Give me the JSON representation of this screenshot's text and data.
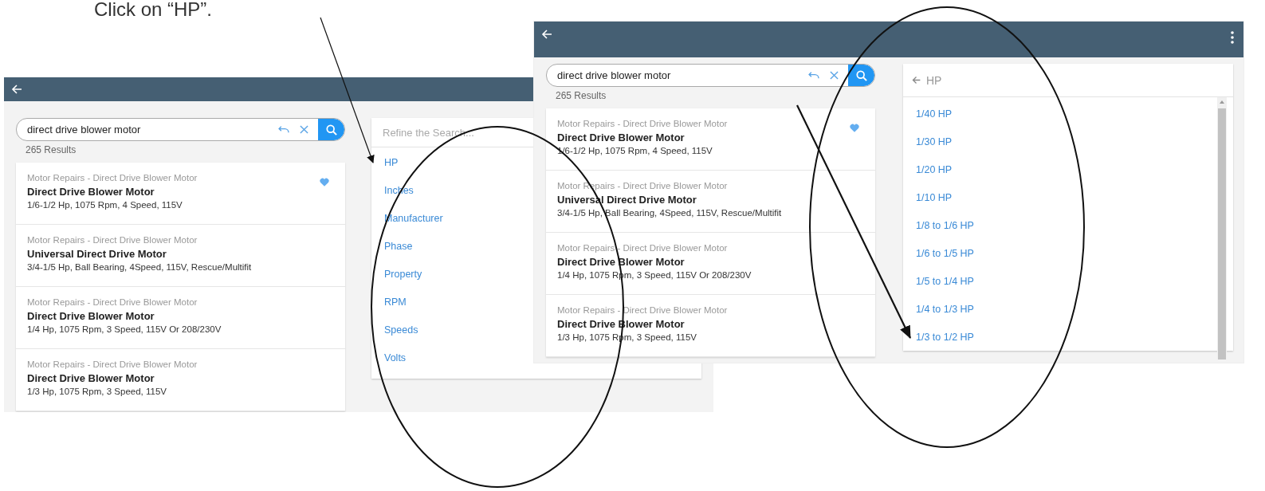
{
  "caption": "Click on “HP”.",
  "screenshots": [
    {
      "menu_button": false,
      "search": {
        "value": "direct drive blower motor"
      },
      "results_count": "265 Results",
      "results": [
        {
          "category": "Motor Repairs - Direct Drive Blower Motor",
          "title": "Direct Drive Blower Motor",
          "details": "1/6-1/2 Hp, 1075 Rpm, 4 Speed, 115V",
          "favorite": true
        },
        {
          "category": "Motor Repairs - Direct Drive Blower Motor",
          "title": "Universal Direct Drive Motor",
          "details": "3/4-1/5 Hp, Ball Bearing, 4Speed, 115V, Rescue/Multifit",
          "favorite": false
        },
        {
          "category": "Motor Repairs - Direct Drive Blower Motor",
          "title": "Direct Drive Blower Motor",
          "details": "1/4 Hp, 1075 Rpm, 3 Speed, 115V Or 208/230V",
          "favorite": false
        },
        {
          "category": "Motor Repairs - Direct Drive Blower Motor",
          "title": "Direct Drive Blower Motor",
          "details": "1/3 Hp, 1075 Rpm, 3 Speed, 115V",
          "favorite": false
        }
      ],
      "panel": {
        "kind": "refine",
        "placeholder": "Refine the Search...",
        "items": [
          "HP",
          "Inches",
          "Manufacturer",
          "Phase",
          "Property",
          "RPM",
          "Speeds",
          "Volts"
        ]
      }
    },
    {
      "menu_button": true,
      "search": {
        "value": "direct drive blower motor"
      },
      "results_count": "265 Results",
      "results": [
        {
          "category": "Motor Repairs - Direct Drive Blower Motor",
          "title": "Direct Drive Blower Motor",
          "details": "1/6-1/2 Hp, 1075 Rpm, 4 Speed, 115V",
          "favorite": true
        },
        {
          "category": "Motor Repairs - Direct Drive Blower Motor",
          "title": "Universal Direct Drive Motor",
          "details": "3/4-1/5 Hp, Ball Bearing, 4Speed, 115V, Rescue/Multifit",
          "favorite": false
        },
        {
          "category": "Motor Repairs - Direct Drive Blower Motor",
          "title": "Direct Drive Blower Motor",
          "details": "1/4 Hp, 1075 Rpm, 3 Speed, 115V Or 208/230V",
          "favorite": false
        },
        {
          "category": "Motor Repairs - Direct Drive Blower Motor",
          "title": "Direct Drive Blower Motor",
          "details": "1/3 Hp, 1075 Rpm, 3 Speed, 115V",
          "favorite": false
        }
      ],
      "panel": {
        "kind": "values",
        "title": "HP",
        "items": [
          "1/40 HP",
          "1/30 HP",
          "1/20 HP",
          "1/10 HP",
          "1/8 to 1/6 HP",
          "1/6 to 1/5 HP",
          "1/5 to 1/4 HP",
          "1/4 to 1/3 HP",
          "1/3 to 1/2 HP"
        ]
      }
    }
  ]
}
